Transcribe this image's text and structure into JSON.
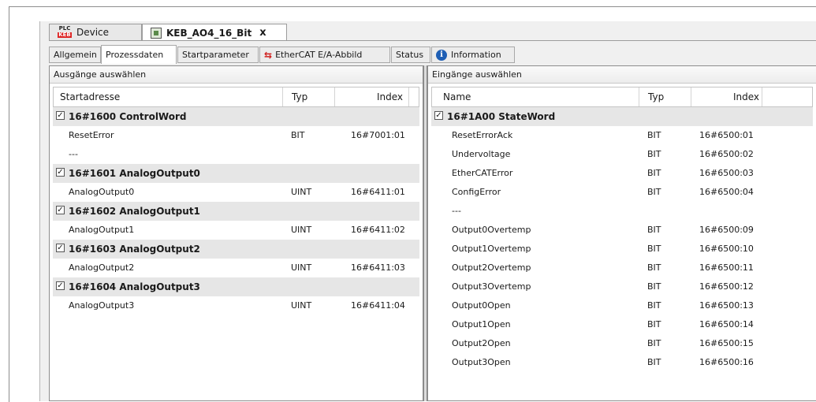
{
  "doc_tabs": [
    {
      "label": "Device",
      "icon": "plc-keb-icon"
    },
    {
      "label": "KEB_AO4_16_Bit",
      "icon": "device-icon",
      "close": "x"
    }
  ],
  "plc_icon": {
    "top": "PLC",
    "bottom": "KEB"
  },
  "sub_tabs": [
    {
      "label": "Allgemein"
    },
    {
      "label": "Prozessdaten"
    },
    {
      "label": "Startparameter"
    },
    {
      "label": "EtherCAT E/A-Abbild"
    },
    {
      "label": "Status"
    },
    {
      "label": "Information"
    }
  ],
  "outputs": {
    "title": "Ausgänge auswählen",
    "columns": [
      "Startadresse",
      "Typ",
      "Index"
    ],
    "rows": [
      {
        "group": true,
        "name": "16#1600 ControlWord",
        "typ": "",
        "index": ""
      },
      {
        "group": false,
        "name": "ResetError",
        "typ": "BIT",
        "index": "16#7001:01"
      },
      {
        "group": false,
        "name": "---",
        "typ": "",
        "index": ""
      },
      {
        "group": true,
        "name": "16#1601 AnalogOutput0",
        "typ": "",
        "index": ""
      },
      {
        "group": false,
        "name": "AnalogOutput0",
        "typ": "UINT",
        "index": "16#6411:01"
      },
      {
        "group": true,
        "name": "16#1602 AnalogOutput1",
        "typ": "",
        "index": ""
      },
      {
        "group": false,
        "name": "AnalogOutput1",
        "typ": "UINT",
        "index": "16#6411:02"
      },
      {
        "group": true,
        "name": "16#1603 AnalogOutput2",
        "typ": "",
        "index": ""
      },
      {
        "group": false,
        "name": "AnalogOutput2",
        "typ": "UINT",
        "index": "16#6411:03"
      },
      {
        "group": true,
        "name": "16#1604 AnalogOutput3",
        "typ": "",
        "index": ""
      },
      {
        "group": false,
        "name": "AnalogOutput3",
        "typ": "UINT",
        "index": "16#6411:04"
      }
    ]
  },
  "inputs": {
    "title": "Eingänge auswählen",
    "columns": [
      "Name",
      "Typ",
      "Index"
    ],
    "rows": [
      {
        "group": true,
        "name": "16#1A00 StateWord",
        "typ": "",
        "index": ""
      },
      {
        "group": false,
        "name": "ResetErrorAck",
        "typ": "BIT",
        "index": "16#6500:01"
      },
      {
        "group": false,
        "name": "Undervoltage",
        "typ": "BIT",
        "index": "16#6500:02"
      },
      {
        "group": false,
        "name": "EtherCATError",
        "typ": "BIT",
        "index": "16#6500:03"
      },
      {
        "group": false,
        "name": "ConfigError",
        "typ": "BIT",
        "index": "16#6500:04"
      },
      {
        "group": false,
        "name": "---",
        "typ": "",
        "index": ""
      },
      {
        "group": false,
        "name": "Output0Overtemp",
        "typ": "BIT",
        "index": "16#6500:09"
      },
      {
        "group": false,
        "name": "Output1Overtemp",
        "typ": "BIT",
        "index": "16#6500:10"
      },
      {
        "group": false,
        "name": "Output2Overtemp",
        "typ": "BIT",
        "index": "16#6500:11"
      },
      {
        "group": false,
        "name": "Output3Overtemp",
        "typ": "BIT",
        "index": "16#6500:12"
      },
      {
        "group": false,
        "name": "Output0Open",
        "typ": "BIT",
        "index": "16#6500:13"
      },
      {
        "group": false,
        "name": "Output1Open",
        "typ": "BIT",
        "index": "16#6500:14"
      },
      {
        "group": false,
        "name": "Output2Open",
        "typ": "BIT",
        "index": "16#6500:15"
      },
      {
        "group": false,
        "name": "Output3Open",
        "typ": "BIT",
        "index": "16#6500:16"
      }
    ]
  },
  "checkbox_mark": "✓"
}
